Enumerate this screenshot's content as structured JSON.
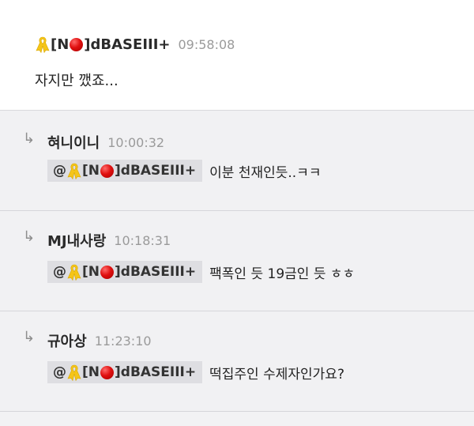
{
  "post": {
    "author": {
      "prefix": "[N",
      "suffix": "]dBASEIII+"
    },
    "time": "09:58:08",
    "body": "자지만 깼죠..."
  },
  "replies": [
    {
      "author": "혀니이니",
      "time": "10:00:32",
      "mention": {
        "at": "@",
        "prefix": "[N",
        "suffix": "]dBASEIII+"
      },
      "text": "이분 천재인듯..ㅋㅋ"
    },
    {
      "author": "MJ내사랑",
      "time": "10:18:31",
      "mention": {
        "at": "@",
        "prefix": "[N",
        "suffix": "]dBASEIII+"
      },
      "text": "팩폭인 듯 19금인 듯 ㅎㅎ"
    },
    {
      "author": "규아상",
      "time": "11:23:10",
      "mention": {
        "at": "@",
        "prefix": "[N",
        "suffix": "]dBASEIII+"
      },
      "text": "떡집주인 수제자인가요?"
    }
  ],
  "reply_arrow": "↳",
  "icons": {
    "ribbon": "yellow-ribbon-icon",
    "dot": "red-dot-icon"
  },
  "colors": {
    "ribbon": "#f5c518",
    "dot": "#e01010",
    "mention_bg": "#dedee2",
    "reply_bg": "#f1f1f3",
    "time": "#9a9a9a"
  }
}
